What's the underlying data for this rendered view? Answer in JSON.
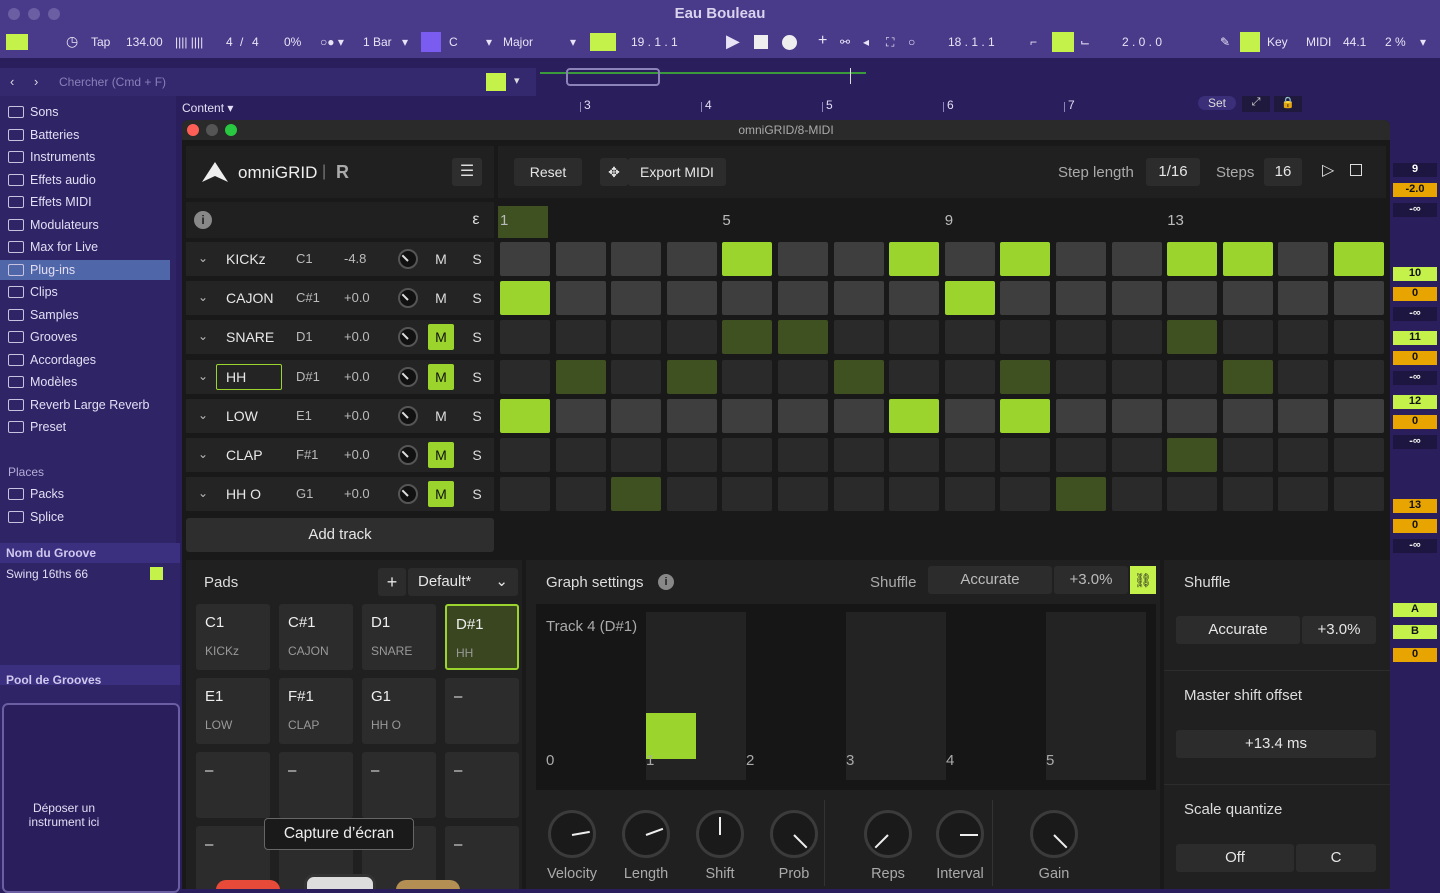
{
  "window": {
    "title": "Eau Bouleau"
  },
  "transport": {
    "tap": "Tap",
    "tempo": "134.00",
    "sig_num": "4",
    "sig_sep": "/",
    "sig_den": "4",
    "swing": "0%",
    "quant": "1 Bar",
    "key": "C",
    "scale": "Major",
    "pos1": "19 .   1 .   1",
    "pos2": "18 .   1 .   1",
    "pos3": "2 .   0 .   0",
    "key_label": "Key",
    "midi_label": "MIDI",
    "cpu": "44.1",
    "cpu2": "2 %"
  },
  "browser": {
    "search_placeholder": "Chercher (Cmd + F)",
    "content_label": "Content ▾",
    "items": [
      "Sons",
      "Batteries",
      "Instruments",
      "Effets audio",
      "Effets MIDI",
      "Modulateurs",
      "Max for Live",
      "Plug-ins",
      "Clips",
      "Samples",
      "Grooves",
      "Accordages",
      "Modèles",
      "Reverb Large Reverb",
      "Preset"
    ],
    "places_header": "Places",
    "places": [
      "Packs",
      "Splice"
    ],
    "groove_header": "Nom du Groove",
    "groove_value": "Swing 16ths 66",
    "pool_label": "Pool de Grooves",
    "drop_label": "Déposer un instrument ici"
  },
  "timeline": {
    "marks": [
      "3",
      "4",
      "5",
      "6",
      "7"
    ],
    "set_label": "Set"
  },
  "plugin": {
    "window_title": "omniGRID/8-MIDI",
    "logo": "omniGRID",
    "logo_r": "R",
    "reset": "Reset",
    "export": "Export MIDI",
    "step_length_label": "Step length",
    "step_length": "1/16",
    "steps_label": "Steps",
    "steps": "16",
    "epsilon": "ε",
    "ruler": [
      "1",
      "5",
      "9",
      "13"
    ],
    "add_track": "Add track",
    "tracks": [
      {
        "name": "KICKz",
        "note": "C1",
        "gain": "-4.8",
        "mute_on": false,
        "m": "M",
        "s": "S"
      },
      {
        "name": "CAJON",
        "note": "C#1",
        "gain": "+0.0",
        "mute_on": false,
        "m": "M",
        "s": "S"
      },
      {
        "name": "SNARE",
        "note": "D1",
        "gain": "+0.0",
        "mute_on": true,
        "m": "M",
        "s": "S"
      },
      {
        "name": "HH",
        "note": "D#1",
        "gain": "+0.0",
        "mute_on": true,
        "m": "M",
        "s": "S"
      },
      {
        "name": "LOW",
        "note": "E1",
        "gain": "+0.0",
        "mute_on": false,
        "m": "M",
        "s": "S"
      },
      {
        "name": "CLAP",
        "note": "F#1",
        "gain": "+0.0",
        "mute_on": true,
        "m": "M",
        "s": "S"
      },
      {
        "name": "HH O",
        "note": "G1",
        "gain": "+0.0",
        "mute_on": true,
        "m": "M",
        "s": "S"
      }
    ],
    "grid": [
      [
        0,
        0,
        0,
        0,
        1,
        0,
        0,
        1,
        0,
        1,
        0,
        0,
        1,
        1,
        0,
        1
      ],
      [
        1,
        0,
        0,
        0,
        0,
        0,
        0,
        0,
        1,
        0,
        0,
        0,
        0,
        0,
        0,
        0
      ],
      [
        3,
        3,
        3,
        3,
        2,
        2,
        3,
        3,
        3,
        3,
        3,
        3,
        2,
        3,
        3,
        3
      ],
      [
        3,
        2,
        3,
        2,
        3,
        3,
        2,
        3,
        3,
        2,
        3,
        3,
        3,
        2,
        3,
        3
      ],
      [
        1,
        0,
        0,
        0,
        0,
        0,
        0,
        1,
        0,
        1,
        0,
        0,
        0,
        0,
        0,
        0
      ],
      [
        3,
        3,
        3,
        3,
        3,
        3,
        3,
        3,
        3,
        3,
        3,
        3,
        2,
        3,
        3,
        3
      ],
      [
        3,
        3,
        2,
        3,
        3,
        3,
        3,
        3,
        3,
        3,
        2,
        3,
        3,
        3,
        3,
        3
      ]
    ],
    "pads_label": "Pads",
    "pads_preset": "Default*",
    "pads_add": "+",
    "pads": [
      {
        "note": "C1",
        "label": "KICKz"
      },
      {
        "note": "C#1",
        "label": "CAJON"
      },
      {
        "note": "D1",
        "label": "SNARE"
      },
      {
        "note": "D#1",
        "label": "HH"
      },
      {
        "note": "E1",
        "label": "LOW"
      },
      {
        "note": "F#1",
        "label": "CLAP"
      },
      {
        "note": "G1",
        "label": "HH O"
      },
      {
        "note": "–",
        "label": ""
      },
      {
        "note": "–",
        "label": ""
      },
      {
        "note": "–",
        "label": ""
      },
      {
        "note": "–",
        "label": ""
      },
      {
        "note": "–",
        "label": ""
      },
      {
        "note": "–",
        "label": ""
      },
      {
        "note": "",
        "label": ""
      },
      {
        "note": "",
        "label": ""
      },
      {
        "note": "–",
        "label": ""
      }
    ],
    "tooltip": "Capture d’écran",
    "graph_settings_label": "Graph settings",
    "graph_shuffle_label": "Shuffle",
    "graph_shuffle_mode": "Accurate",
    "graph_shuffle_amount": "+3.0%",
    "graph_track": "Track 4 (D#1)",
    "graph_axis": [
      "0",
      "1",
      "2",
      "3",
      "4",
      "5"
    ],
    "graph_value": 0.4,
    "knobs": [
      {
        "label": "Velocity",
        "angle": 80
      },
      {
        "label": "Length",
        "angle": 70
      },
      {
        "label": "Shift",
        "angle": 0
      },
      {
        "label": "Prob",
        "angle": 135
      },
      {
        "label": "Reps",
        "angle": -135
      },
      {
        "label": "Interval",
        "angle": 90
      },
      {
        "label": "Gain",
        "angle": 135
      }
    ],
    "side": {
      "shuffle_label": "Shuffle",
      "shuffle_mode": "Accurate",
      "shuffle_amount": "+3.0%",
      "master_label": "Master shift offset",
      "master_value": "+13.4 ms",
      "scale_label": "Scale quantize",
      "scale_mode": "Off",
      "scale_key": "C"
    }
  },
  "right_panel": [
    "9",
    "-2.0",
    "-∞",
    "10",
    "0",
    "-∞",
    "11",
    "0",
    "-∞",
    "12",
    "0",
    "-∞",
    "13",
    "0",
    "-∞",
    "A",
    "B",
    "0"
  ]
}
